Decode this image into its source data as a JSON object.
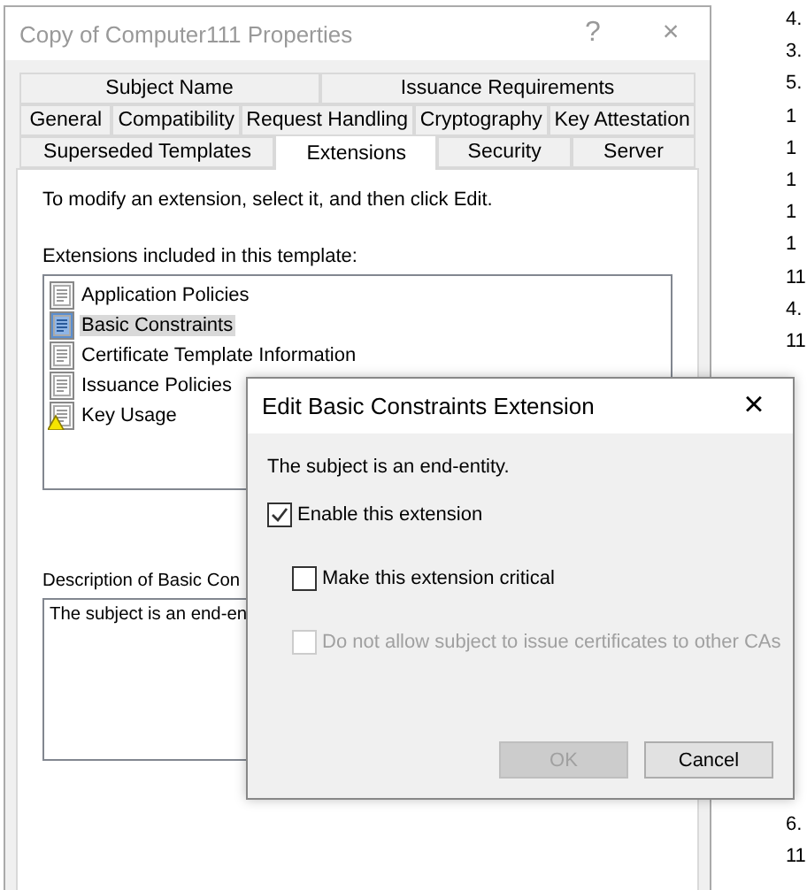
{
  "window": {
    "title": "Copy of Computer111 Properties",
    "help": "?",
    "close": "×"
  },
  "tab_rows": [
    [
      {
        "label": "Subject Name",
        "selected": false
      },
      {
        "label": "Issuance Requirements",
        "selected": false
      }
    ],
    [
      {
        "label": "General",
        "selected": false
      },
      {
        "label": "Compatibility",
        "selected": false
      },
      {
        "label": "Request Handling",
        "selected": false
      },
      {
        "label": "Cryptography",
        "selected": false
      },
      {
        "label": "Key Attestation",
        "selected": false
      }
    ],
    [
      {
        "label": "Superseded Templates",
        "selected": false
      },
      {
        "label": "Extensions",
        "selected": true
      },
      {
        "label": "Security",
        "selected": false
      },
      {
        "label": "Server",
        "selected": false
      }
    ]
  ],
  "instruction": "To modify an extension, select it, and then click Edit.",
  "extensions_label": "Extensions included in this template:",
  "extensions": [
    {
      "label": "Application Policies",
      "selected": false,
      "warning": false
    },
    {
      "label": "Basic Constraints",
      "selected": true,
      "warning": false
    },
    {
      "label": "Certificate Template Information",
      "selected": false,
      "warning": false
    },
    {
      "label": "Issuance Policies",
      "selected": false,
      "warning": false
    },
    {
      "label": "Key Usage",
      "selected": false,
      "warning": true
    }
  ],
  "description_label": "Description of Basic Con",
  "description": "The subject is an end-en",
  "background_list": [
    "4.",
    "3.",
    "5.",
    "1",
    "1",
    "1",
    "1",
    "1",
    "11",
    "4.",
    "11"
  ],
  "background_list_lower": [
    "6.",
    "11"
  ],
  "dialog": {
    "title": "Edit Basic Constraints Extension",
    "close": "×",
    "message": "The subject is an end-entity.",
    "options": [
      {
        "label": "Enable this extension",
        "checked": true,
        "disabled": false,
        "children": [
          {
            "label": "Make this extension critical",
            "checked": false,
            "disabled": false
          },
          {
            "label": "Do not allow subject to issue certificates to other CAs",
            "checked": false,
            "disabled": true
          }
        ]
      }
    ],
    "buttons": [
      {
        "label": "OK",
        "disabled": true
      },
      {
        "label": "Cancel",
        "disabled": false
      }
    ]
  }
}
